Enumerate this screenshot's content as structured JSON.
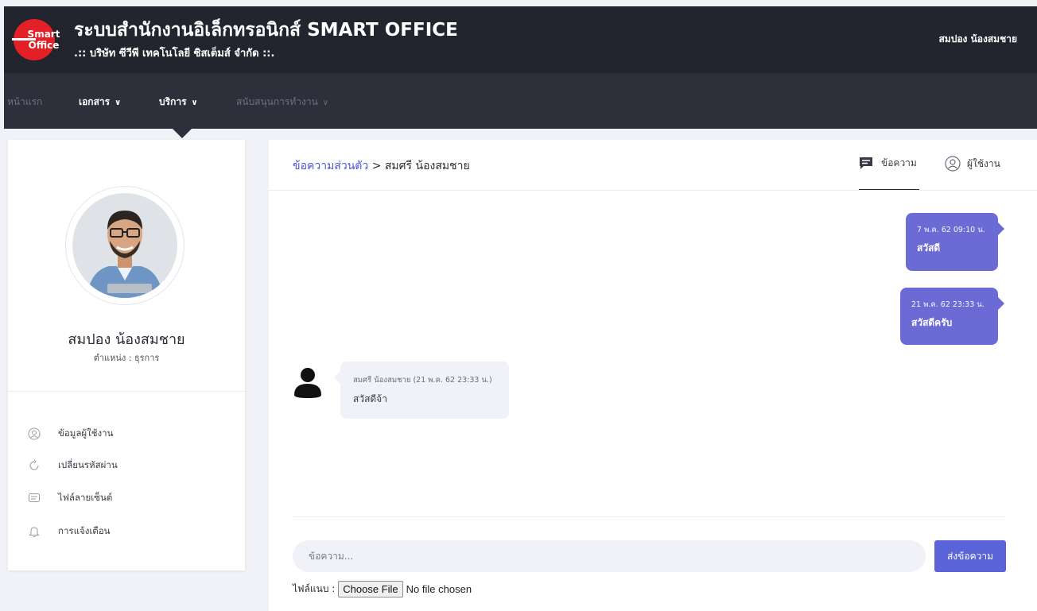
{
  "header": {
    "title": "ระบบสำนักงานอิเล็กทรอนิกส์ SMART OFFICE",
    "subtitle": ".:: บริษัท ซีวีพี เทคโนโลยี ซิสเต็มส์ จำกัด ::.",
    "logo_text_top": "Smart",
    "logo_text_bottom": "Office",
    "user_name": "สมปอง น้องสมชาย"
  },
  "nav": {
    "items": [
      {
        "label": "หน้าแรก"
      },
      {
        "label": "เอกสาร"
      },
      {
        "label": "บริการ"
      },
      {
        "label": "สนับสนุนการทำงาน"
      }
    ]
  },
  "profile": {
    "name": "สมปอง น้องสมชาย",
    "position": "ตำแหน่ง : ธุรการ",
    "menu": [
      {
        "label": "ข้อมูลผู้ใช้งาน",
        "icon": "user-icon"
      },
      {
        "label": "เปลี่ยนรหัสผ่าน",
        "icon": "refresh-icon"
      },
      {
        "label": "ไฟล์ลายเซ็นต์",
        "icon": "file-icon"
      },
      {
        "label": "การแจ้งเตือน",
        "icon": "bell-icon"
      }
    ]
  },
  "chat": {
    "breadcrumb_link": "ข้อความส่วนตัว",
    "breadcrumb_current": "> สมศรี น้องสมชาย",
    "tabs": [
      {
        "label": "ข้อความ",
        "icon": "chat-icon"
      },
      {
        "label": "ผู้ใช้งาน",
        "icon": "user-circle-icon"
      }
    ],
    "messages": [
      {
        "direction": "out",
        "meta": "7 พ.ค. 62 09:10 น.",
        "text": "สวัสดี"
      },
      {
        "direction": "out",
        "meta": "21 พ.ค. 62 23:33 น.",
        "text": "สวัสดีครับ"
      },
      {
        "direction": "in",
        "meta": "สมศรี น้องสมชาย (21 พ.ค. 62 23:33 น.)",
        "text": "สวัสดีจ้า"
      }
    ],
    "input_placeholder": "ข้อความ...",
    "send_label": "ส่งข้อความ",
    "attach_label": "ไฟล์แนบ :",
    "file_button_label": "Choose File",
    "file_status": "No file chosen"
  },
  "colors": {
    "header_bg": "#22242e",
    "nav_bg": "#2d2f3b",
    "accent": "#6c6bd6",
    "send_button": "#5a63d8",
    "link": "#4b55d4",
    "logo_red": "#e32026"
  }
}
